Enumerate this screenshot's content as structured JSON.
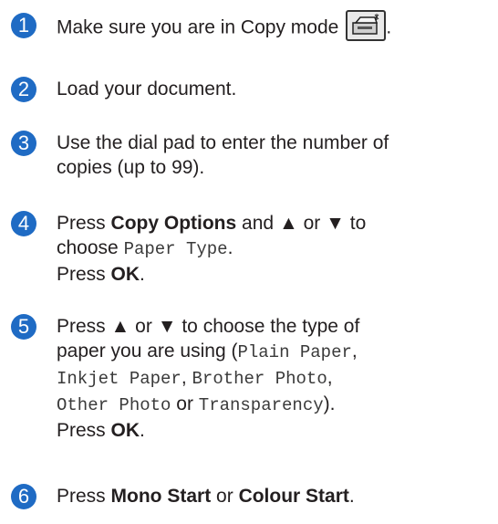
{
  "steps": [
    {
      "number": "1",
      "text": "Make sure you are in Copy mode",
      "icon": "copy-mode-icon",
      "trailing": "."
    },
    {
      "number": "2",
      "text": "Load your document."
    },
    {
      "number": "3",
      "line1": "Use the dial pad to enter the number of",
      "line2": "copies (up to 99)."
    },
    {
      "number": "4",
      "press": "Press",
      "button_copy_options": "Copy Options",
      "and": "and",
      "up_symbol": "▲",
      "or": "or",
      "down_symbol": "▼",
      "to": "to",
      "choose": "choose",
      "menu_item": "Paper Type",
      "period": ".",
      "press2": "Press",
      "ok": "OK",
      "period2": "."
    },
    {
      "number": "5",
      "press": "Press",
      "up_symbol": "▲",
      "or": "or",
      "down_symbol": "▼",
      "text1": "to choose the type of",
      "text2": "paper you are using (",
      "opt1": "Plain Paper",
      "comma1": ",",
      "opt2": "Inkjet Paper",
      "comma2": ",",
      "opt3": "Brother Photo",
      "comma3": ",",
      "opt4": "Other Photo",
      "or2": "or",
      "opt5": "Transparency",
      "close": ").",
      "press2": "Press",
      "ok": "OK",
      "period": "."
    },
    {
      "number": "6",
      "press": "Press",
      "mono_start": "Mono Start",
      "or": "or",
      "colour_start": "Colour Start",
      "period": "."
    }
  ]
}
